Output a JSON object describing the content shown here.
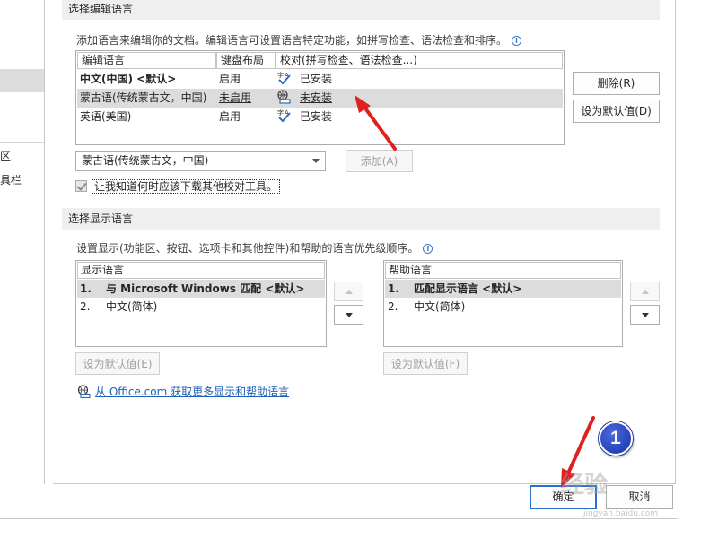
{
  "left_nav": {
    "item_1": "区",
    "item_2": "具栏"
  },
  "editing_language": {
    "section_title": "选择编辑语言",
    "description": "添加语言来编辑你的文档。编辑语言可设置语言特定功能，如拼写检查、语法检查和排序。",
    "columns": [
      "编辑语言",
      "键盘布局",
      "校对(拼写检查、语法检查...)"
    ],
    "rows": [
      {
        "language": "中文(中国) <默认>",
        "keyboard": "启用",
        "proofing": "已安装"
      },
      {
        "language": "蒙古语(传统蒙古文，中国)",
        "keyboard": "未启用",
        "proofing": "未安装"
      },
      {
        "language": "英语(美国)",
        "keyboard": "启用",
        "proofing": "已安装"
      }
    ],
    "remove_button": "删除(R)",
    "set_default_button": "设为默认值(D)",
    "add_language_select": "蒙古语(传统蒙古文，中国)",
    "add_button": "添加(A)",
    "notify_checkbox": "让我知道何时应该下载其他校对工具。"
  },
  "display_language": {
    "section_title": "选择显示语言",
    "description": "设置显示(功能区、按钮、选项卡和其他控件)和帮助的语言优先级顺序。",
    "display_list": {
      "header": "显示语言",
      "items": [
        {
          "num": "1.",
          "label": "与 Microsoft Windows 匹配 <默认>"
        },
        {
          "num": "2.",
          "label": "中文(简体)"
        }
      ],
      "set_default_button": "设为默认值(E)"
    },
    "help_list": {
      "header": "帮助语言",
      "items": [
        {
          "num": "1.",
          "label": "匹配显示语言 <默认>"
        },
        {
          "num": "2.",
          "label": "中文(简体)"
        }
      ],
      "set_default_button": "设为默认值(F)"
    },
    "office_link": "从 Office.com 获取更多显示和帮助语言"
  },
  "footer": {
    "ok_button": "确定",
    "cancel_button": "取消"
  },
  "annotation": {
    "step_badge": "1",
    "watermark": "经验",
    "watermark_url": "jingyan.baidu.com"
  },
  "colors": {
    "arrow_red": "#e02020",
    "link_blue": "#1f5fb5",
    "badge_blue": "#1530a8",
    "focus_border": "#2a6fc9"
  }
}
